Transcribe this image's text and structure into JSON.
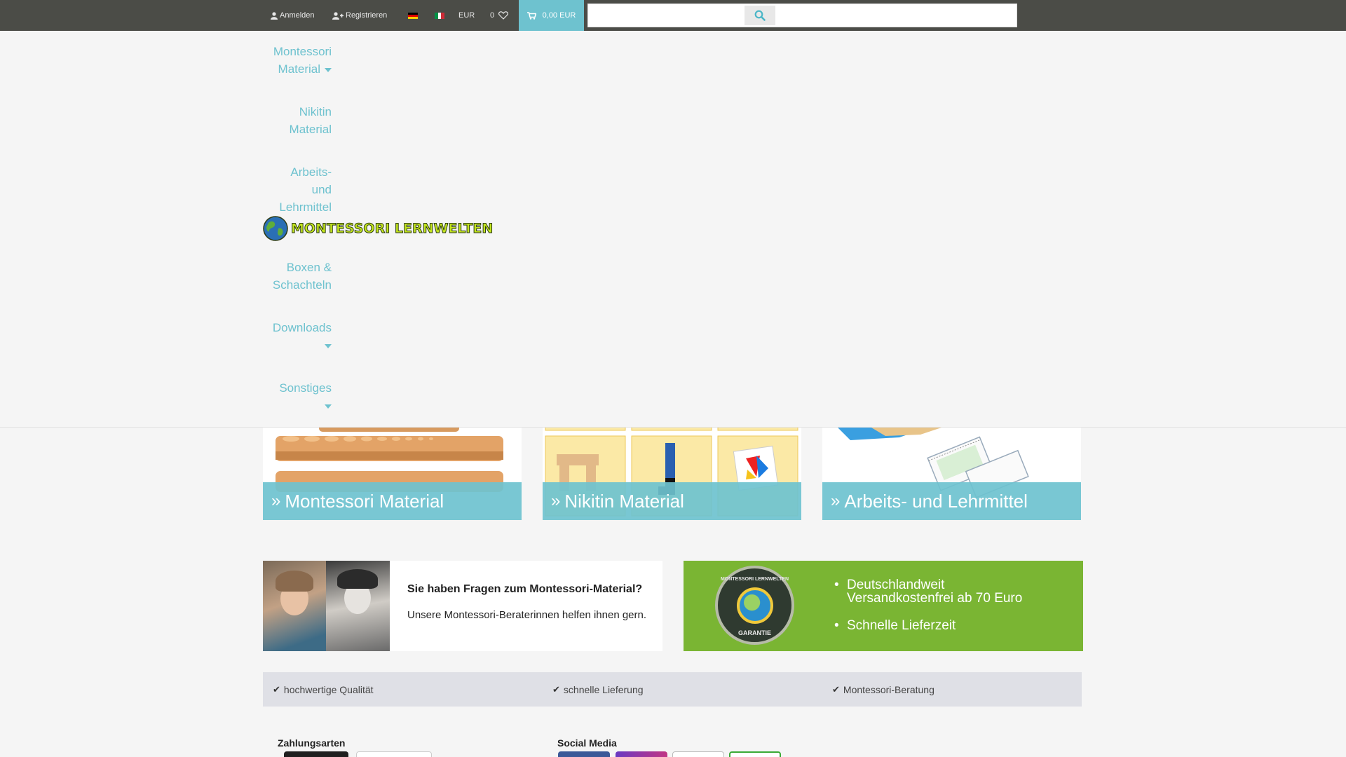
{
  "topbar": {
    "login_label": "Anmelden",
    "register_label": "Registrieren",
    "currency_label": "EUR",
    "wishlist_count": "0",
    "cart_total": "0,00 EUR",
    "search_placeholder": ""
  },
  "menu": {
    "items": [
      {
        "label_line1": "Montessori",
        "label_line2": "Material",
        "has_dropdown": true
      },
      {
        "label_line1": "Nikitin",
        "label_line2": "Material",
        "has_dropdown": false
      },
      {
        "label_line1": "Arbeits-",
        "label_line2": "und",
        "label_line3": "Lehrmittel",
        "has_dropdown": false
      },
      {
        "label_line1": "Boxen &",
        "label_line2": "Schachteln",
        "has_dropdown": false
      },
      {
        "label_line1": "Downloads",
        "has_dropdown": true
      },
      {
        "label_line1": "Sonstiges",
        "has_dropdown": true
      }
    ]
  },
  "logo": {
    "text": "MONTESSORI LERNWELTEN"
  },
  "tiles": [
    {
      "label": "Montessori Material"
    },
    {
      "label": "Nikitin Material"
    },
    {
      "label": "Arbeits- und Lehrmittel"
    }
  ],
  "banner_left": {
    "heading": "Sie haben Fragen zum Montessori-Material?",
    "text": "Unsere Montessori-Beraterinnen helfen ihnen gern."
  },
  "banner_right": {
    "seal_top": "MONTESSORI LERNWELTEN",
    "seal_bottom": "GARANTIE",
    "bullet1_line1": "Deutschlandweit",
    "bullet1_line2": "Versandkostenfrei ab 70 Euro",
    "bullet2": "Schnelle Lieferzeit"
  },
  "features": [
    {
      "label": "hochwertige Qualität"
    },
    {
      "label": "schnelle Lieferung"
    },
    {
      "label": "Montessori-Beratung"
    }
  ],
  "footer": {
    "payment_title": "Zahlungsarten",
    "social_title": "Social Media"
  },
  "colors": {
    "accent": "#6ec2cf",
    "topbar": "#4b4c47",
    "banner_green": "#7ab533"
  }
}
